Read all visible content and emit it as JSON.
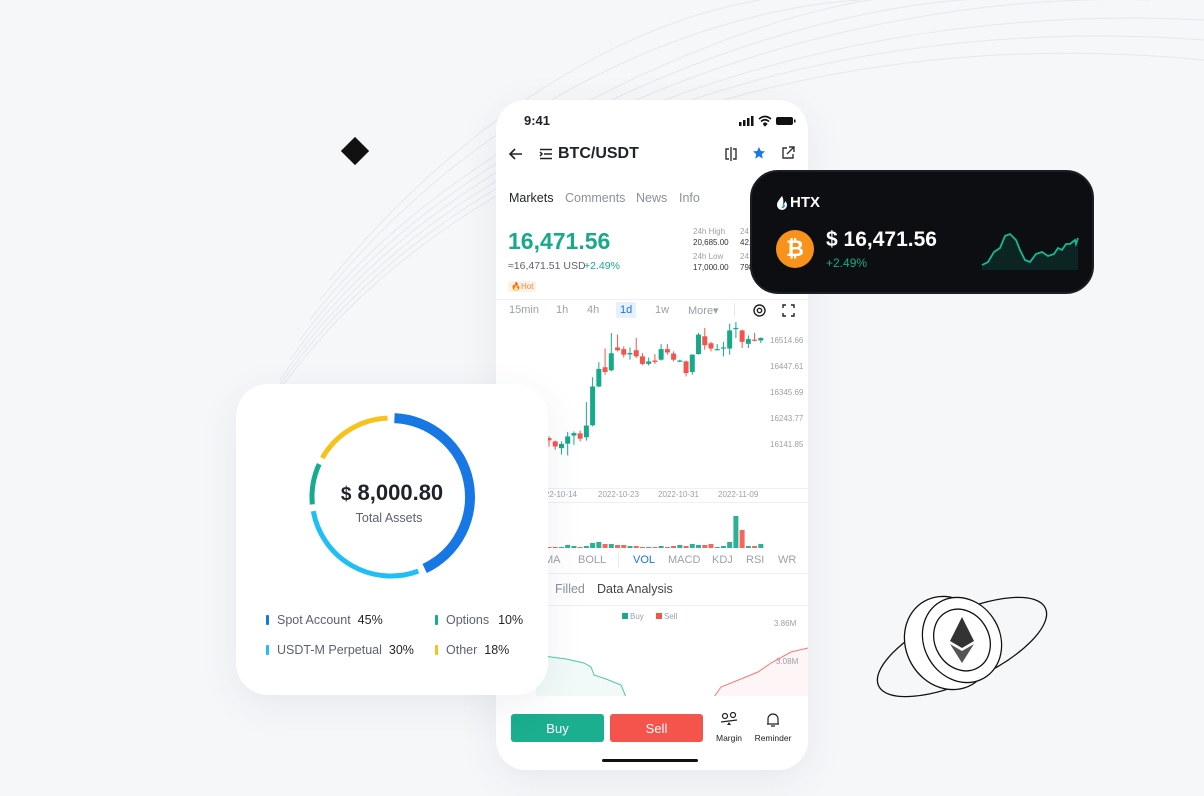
{
  "colors": {
    "green": "#16a98a",
    "red": "#f5544d",
    "blue": "#1677e5",
    "dark_card": "#0c0e12",
    "btc_orange": "#f7931a"
  },
  "status_bar": {
    "time": "9:41",
    "icons": [
      "signal-icon",
      "wifi-icon",
      "battery-icon"
    ]
  },
  "header": {
    "pair": "BTC/USDT",
    "icons": [
      "back-arrow-icon",
      "list-icon",
      "compare-icon",
      "star-icon",
      "share-icon"
    ]
  },
  "tabs": [
    {
      "label": "Markets",
      "active": true
    },
    {
      "label": "Comments"
    },
    {
      "label": "News"
    },
    {
      "label": "Info"
    }
  ],
  "ticker": {
    "price": "16,471.56",
    "usd": "≈16,471.51 USD",
    "change": "+2.49%",
    "badge": "Hot",
    "stats": [
      {
        "label": "24h High",
        "value": "20,685.00"
      },
      {
        "label": "24h Low",
        "value": "17,000.00"
      },
      {
        "label": "24",
        "value": "42."
      },
      {
        "label": "24",
        "value": "798"
      }
    ]
  },
  "timeframes": [
    {
      "label": "15min"
    },
    {
      "label": "1h"
    },
    {
      "label": "4h"
    },
    {
      "label": "1d",
      "active": true
    },
    {
      "label": "1w"
    },
    {
      "label": "More▾"
    }
  ],
  "chart_data": {
    "type": "candlestick",
    "price_ticks": [
      "16514.66",
      "16447.61",
      "16345.69",
      "16243.77",
      "16141.85"
    ],
    "date_ticks": [
      "2022-10-14",
      "2022-10-23",
      "2022-10-31",
      "2022-11-09"
    ],
    "candles_ohlc": [
      [
        16163,
        16169,
        16133,
        16155
      ],
      [
        16151,
        16154,
        16121,
        16133
      ],
      [
        16127,
        16151,
        16104,
        16142
      ],
      [
        16143,
        16185,
        16101,
        16169
      ],
      [
        16172,
        16187,
        16139,
        16181
      ],
      [
        16180,
        16190,
        16151,
        16161
      ],
      [
        16166,
        16292,
        16154,
        16208
      ],
      [
        16209,
        16381,
        16205,
        16348
      ],
      [
        16348,
        16435,
        16345,
        16411
      ],
      [
        16417,
        16484,
        16390,
        16400
      ],
      [
        16406,
        16540,
        16402,
        16467
      ],
      [
        16488,
        16534,
        16474,
        16478
      ],
      [
        16482,
        16492,
        16452,
        16462
      ],
      [
        16463,
        16488,
        16444,
        16468
      ],
      [
        16478,
        16522,
        16450,
        16456
      ],
      [
        16456,
        16468,
        16424,
        16429
      ],
      [
        16429,
        16452,
        16423,
        16438
      ],
      [
        16441,
        16464,
        16429,
        16436
      ],
      [
        16444,
        16500,
        16441,
        16482
      ],
      [
        16482,
        16500,
        16462,
        16470
      ],
      [
        16466,
        16474,
        16438,
        16444
      ],
      [
        16437,
        16444,
        16435,
        16441
      ],
      [
        16438,
        16441,
        16384,
        16396
      ],
      [
        16400,
        16464,
        16390,
        16462
      ],
      [
        16464,
        16540,
        16462,
        16534
      ],
      [
        16528,
        16558,
        16480,
        16496
      ],
      [
        16503,
        16508,
        16474,
        16484
      ],
      [
        16480,
        16500,
        16478,
        16482
      ],
      [
        16486,
        16508,
        16456,
        16488
      ],
      [
        16484,
        16573,
        16462,
        16549
      ],
      [
        16554,
        16579,
        16522,
        16558
      ],
      [
        16549,
        16552,
        16486,
        16508
      ],
      [
        16501,
        16531,
        16486,
        16518
      ],
      [
        16516,
        16540,
        16510,
        16512
      ],
      [
        16513,
        16524,
        16504,
        16522
      ]
    ],
    "volume": [
      1,
      1,
      1,
      3,
      2,
      1,
      2,
      5,
      6,
      4,
      4,
      3,
      3,
      2,
      2,
      1,
      1,
      1,
      2,
      1,
      2,
      3,
      2,
      4,
      3,
      3,
      4,
      1,
      2,
      6,
      32,
      18,
      2,
      2,
      4
    ]
  },
  "indicators": [
    {
      "label": "MA"
    },
    {
      "label": "BOLL"
    },
    {
      "label": "VOL",
      "active": true
    },
    {
      "label": "MACD"
    },
    {
      "label": "KDJ"
    },
    {
      "label": "RSI"
    },
    {
      "label": "WR"
    }
  ],
  "lower_tabs": [
    {
      "label": "Filled"
    },
    {
      "label": "Data Analysis",
      "active": true
    }
  ],
  "depth": {
    "legend": [
      "Buy",
      "Sell"
    ],
    "ticks": [
      "3.86M",
      "3.08M"
    ]
  },
  "actions": {
    "buy": "Buy",
    "sell": "Sell",
    "margin": "Margin",
    "reminder": "Reminder"
  },
  "htx_card": {
    "logo": "HTX",
    "price": "16,471.56",
    "currency": "$",
    "change": "+2.49%",
    "coin": "BTC"
  },
  "assets": {
    "currency": "$",
    "total": "8,000.80",
    "label": "Total Assets",
    "items": [
      {
        "name": "Spot Account",
        "pct": "45%",
        "value": 45,
        "color": "#1677e5"
      },
      {
        "name": "USDT-M Perpetual",
        "pct": "30%",
        "value": 30,
        "color": "#1fbff5"
      },
      {
        "name": "Options",
        "pct": "10%",
        "value": 10,
        "color": "#14ab90"
      },
      {
        "name": "Other",
        "pct": "18%",
        "value": 18,
        "color": "#f7c21a"
      }
    ]
  }
}
